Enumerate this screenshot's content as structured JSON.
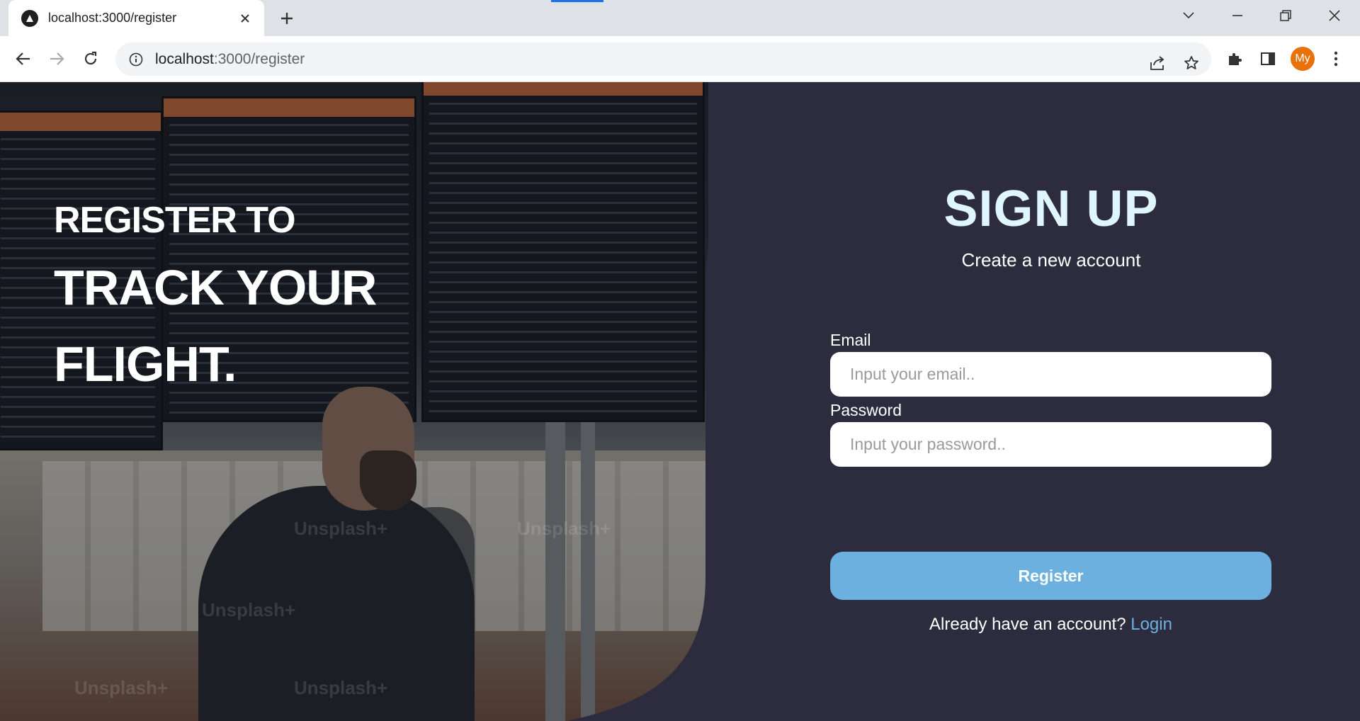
{
  "browser": {
    "tab_title": "localhost:3000/register",
    "url_host": "localhost",
    "url_path": ":3000/register",
    "profile_initials": "My"
  },
  "hero": {
    "line1": "REGISTER TO",
    "line2": "TRACK YOUR",
    "line3": "FLIGHT.",
    "watermark": "Unsplash+"
  },
  "form": {
    "title": "SIGN UP",
    "subtitle": "Create a new account",
    "email_label": "Email",
    "email_placeholder": "Input your email..",
    "password_label": "Password",
    "password_placeholder": "Input your password..",
    "register_label": "Register",
    "login_prompt": "Already have an account?",
    "login_link": "Login"
  },
  "colors": {
    "panel_bg": "#2d2c3e",
    "title": "#dff6ff",
    "accent": "#6cb0df",
    "profile": "#e8710a"
  },
  "icons": {
    "tab_favicon": "triangle-icon",
    "tab_close": "close-icon",
    "new_tab": "plus-icon",
    "back": "arrow-left-icon",
    "forward": "arrow-right-icon",
    "reload": "reload-icon",
    "site_info": "info-icon",
    "share": "share-icon",
    "bookmark": "star-icon",
    "extensions": "puzzle-icon",
    "side_panel": "side-panel-icon",
    "menu": "kebab-menu-icon"
  }
}
